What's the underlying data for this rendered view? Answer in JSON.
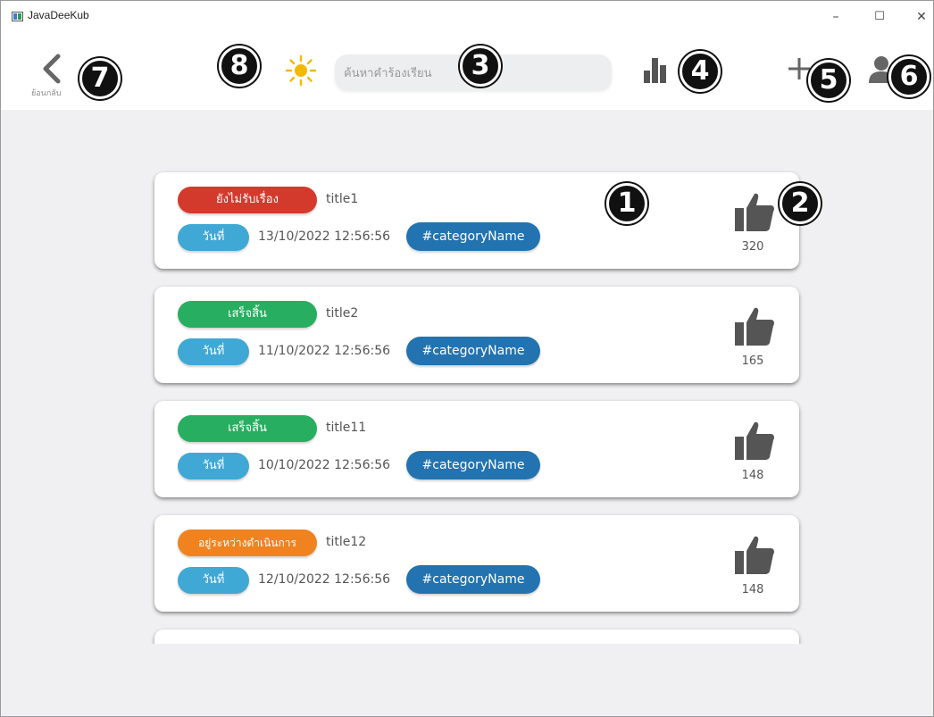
{
  "window": {
    "title": "JavaDeeKub"
  },
  "window_controls": {
    "minimize": "–",
    "maximize": "☐",
    "close": "✕"
  },
  "header": {
    "back_label": "ย้อนกลับ",
    "search_placeholder": "ค้นหาคำร้องเรียน",
    "icons": [
      "back-chevron-icon",
      "sun-theme-icon",
      "bar-chart-icon",
      "plus-icon",
      "user-icon"
    ]
  },
  "annotations": [
    "1",
    "2",
    "3",
    "4",
    "5",
    "6",
    "7",
    "8"
  ],
  "cards": [
    {
      "status": "ยังไม่รับเรื่อง",
      "status_color": "#d33a2c",
      "title": "title1",
      "date_label": "วันที่",
      "date": "13/10/2022 12:56:56",
      "category": "#categoryName",
      "likes": "320"
    },
    {
      "status": "เสร็จสิ้น",
      "status_color": "#27ae60",
      "title": "title2",
      "date_label": "วันที่",
      "date": "11/10/2022 12:56:56",
      "category": "#categoryName",
      "likes": "165"
    },
    {
      "status": "เสร็จสิ้น",
      "status_color": "#27ae60",
      "title": "title11",
      "date_label": "วันที่",
      "date": "10/10/2022 12:56:56",
      "category": "#categoryName",
      "likes": "148"
    },
    {
      "status": "อยู่ระหว่างดำเนินการ",
      "status_color": "#f0831f",
      "title": "title12",
      "date_label": "วันที่",
      "date": "12/10/2022 12:56:56",
      "category": "#categoryName",
      "likes": "148"
    }
  ],
  "colors": {
    "date_pill": "#3fa8d4",
    "category_pill": "#2273b0",
    "icon_gray": "#555555",
    "sun": "#f5b800",
    "partial_card_pill": "#f5d8c4"
  }
}
